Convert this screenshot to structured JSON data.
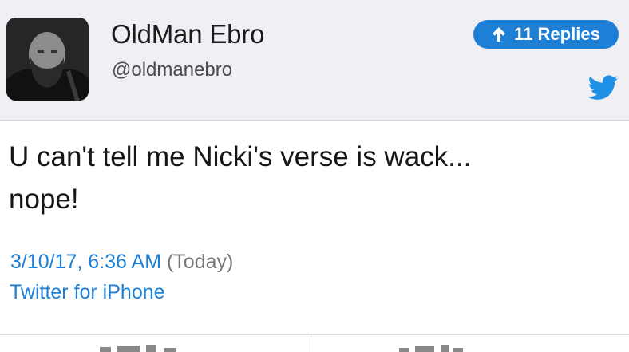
{
  "user": {
    "display_name": "OldMan Ebro",
    "handle": "@oldmanebro"
  },
  "replies_button": {
    "label": "11 Replies",
    "icon": "arrow-up-icon"
  },
  "tweet": {
    "text_line1": "U can't tell me Nicki's verse is wack...",
    "text_line2": "nope!",
    "timestamp": "3/10/17, 6:36 AM",
    "relative": "(Today)",
    "source": "Twitter for iPhone"
  },
  "icons": {
    "brand": "twitter-bird-icon",
    "avatar": "avatar"
  },
  "colors": {
    "accent": "#1e7fd6",
    "header_bg": "#efeff4"
  }
}
